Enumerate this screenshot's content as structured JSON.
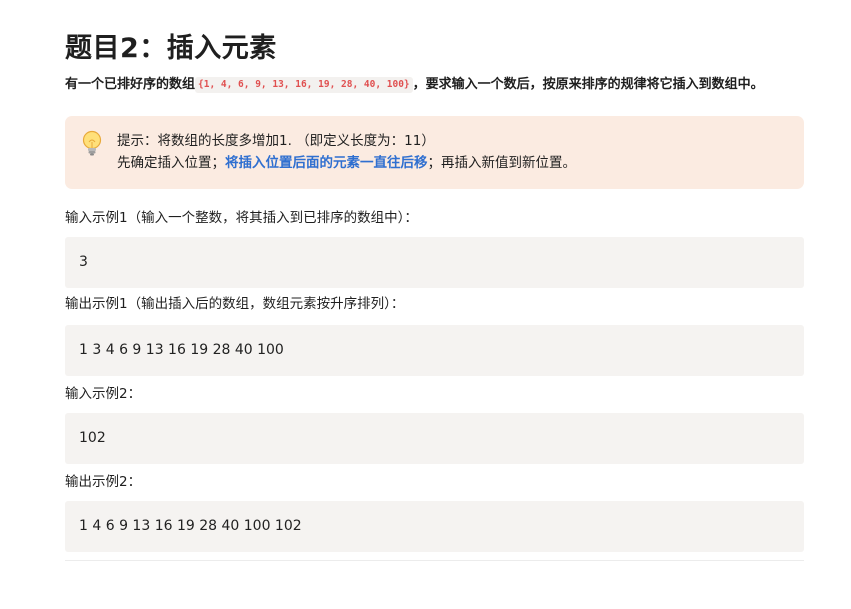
{
  "title": "题目2：插入元素",
  "description": {
    "prefix": "有一个已排好序的数组",
    "array_code": "{1, 4, 6, 9, 13, 16, 19, 28, 40, 100}",
    "suffix": "，要求输入一个数后，按原来排序的规律将它插入到数组中。"
  },
  "callout": {
    "icon": "lightbulb-icon",
    "line1": "提示：将数组的长度多增加1. （即定义长度为：11）",
    "line2_prefix": "先确定插入位置；",
    "line2_highlight": "将插入位置后面的元素一直往后移",
    "line2_suffix": "；再插入新值到新位置。",
    "background": "#fbebe1",
    "highlight_color": "#2f6fd0"
  },
  "examples": [
    {
      "label": "输入示例1（输入一个整数，将其插入到已排序的数组中）：",
      "value": "3"
    },
    {
      "label": "输出示例1（输出插入后的数组，数组元素按升序排列）：",
      "value": "1 3 4 6 9 13 16 19 28 40 100"
    },
    {
      "label": "输入示例2：",
      "value": "102"
    },
    {
      "label": "输出示例2：",
      "value": "1 4 6 9 13 16 19 28 40 100 102"
    }
  ],
  "colors": {
    "code_bg": "#f5f3f1",
    "inline_code": "#e05050"
  }
}
